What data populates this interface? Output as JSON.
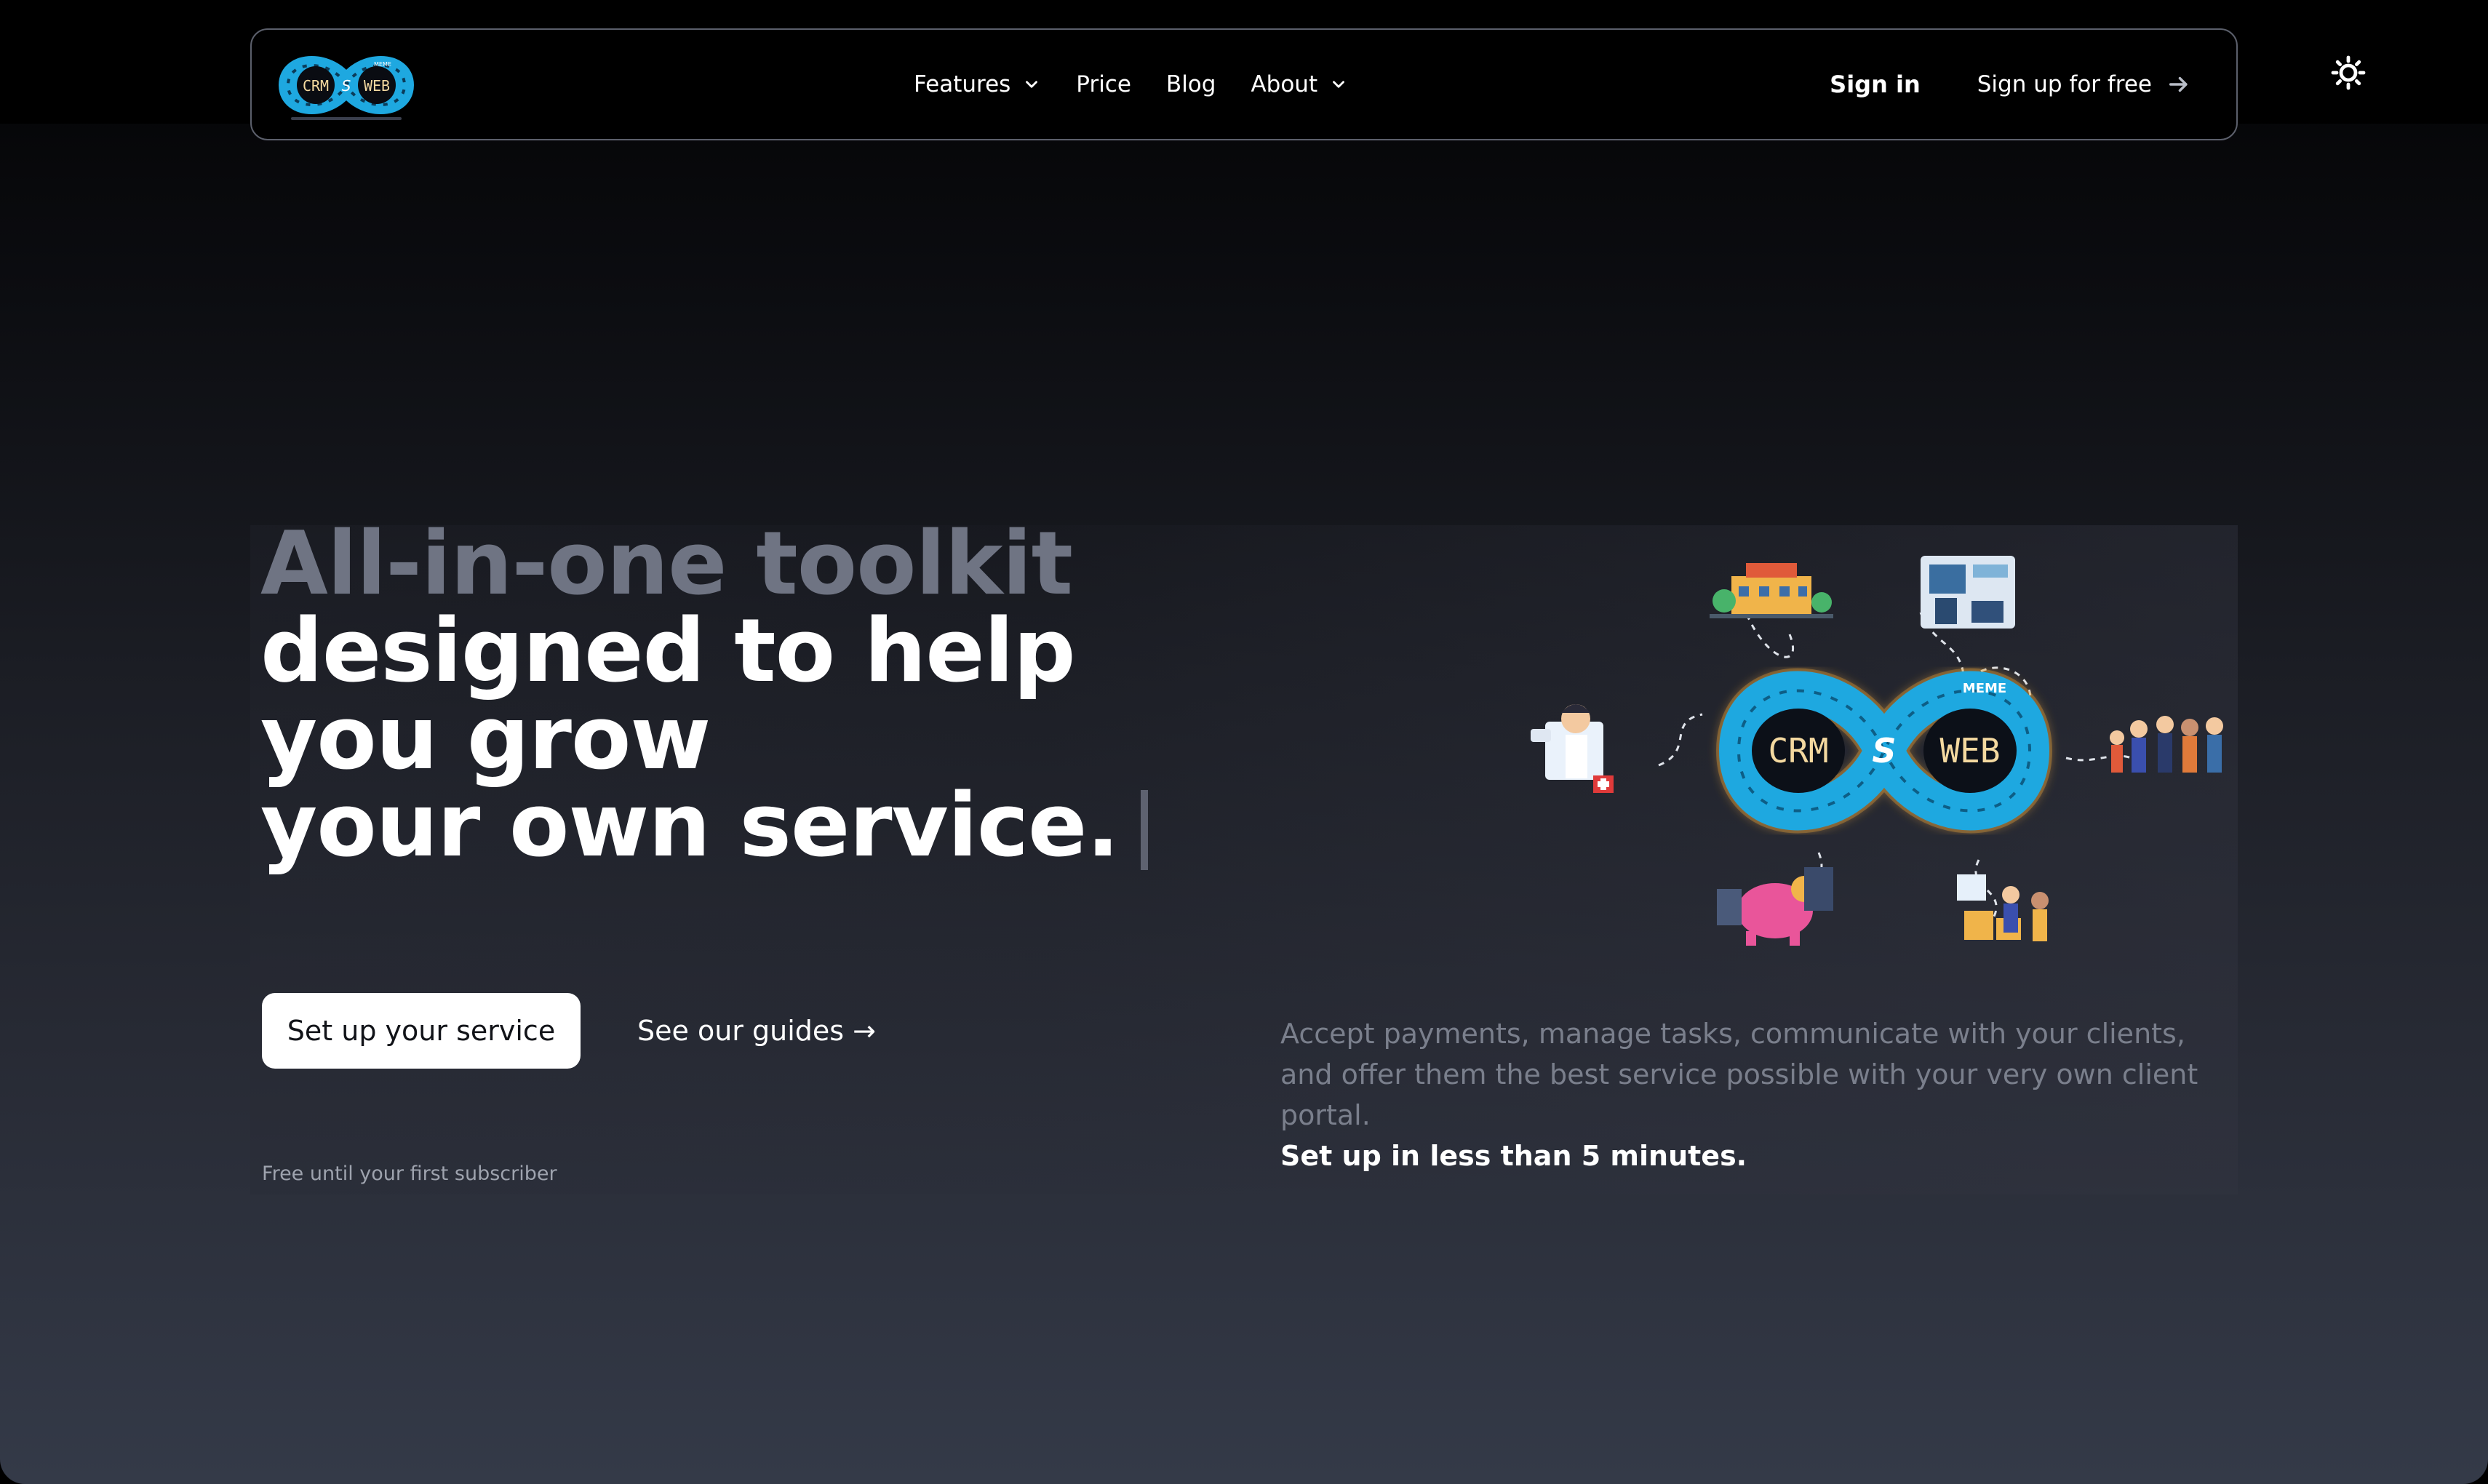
{
  "logo": {
    "left_word": "CRM",
    "middle_letter": "S",
    "right_word": "WEB",
    "badge_text": "MEME"
  },
  "nav": {
    "items": [
      {
        "label": "Features",
        "has_dropdown": true
      },
      {
        "label": "Price",
        "has_dropdown": false
      },
      {
        "label": "Blog",
        "has_dropdown": false
      },
      {
        "label": "About",
        "has_dropdown": true
      }
    ],
    "sign_in": "Sign in",
    "sign_up": "Sign up for free"
  },
  "hero": {
    "headline": {
      "line1": "All-in-one toolkit",
      "line2": "designed to help",
      "line3": "you grow",
      "line4": "your own service."
    },
    "cta_primary": "Set up your service",
    "cta_secondary": "See our guides →",
    "free_note": "Free until your first subscriber",
    "description": "Accept payments, manage tasks, communicate with your clients, and offer them the best service possible with your very own client portal.",
    "description_strong": "Set up in less than 5 minutes."
  },
  "illustration": {
    "left_word": "CRM",
    "middle_letter": "S",
    "right_word": "WEB",
    "badge_text": "MEME"
  },
  "colors": {
    "accent_blue": "#1ea8e0",
    "glow_orange": "#e8a23a",
    "text_white": "#ffffff",
    "text_muted": "#7a7f8c"
  },
  "icons": [
    "chevron-down-icon",
    "arrow-right-icon",
    "sun-icon"
  ]
}
